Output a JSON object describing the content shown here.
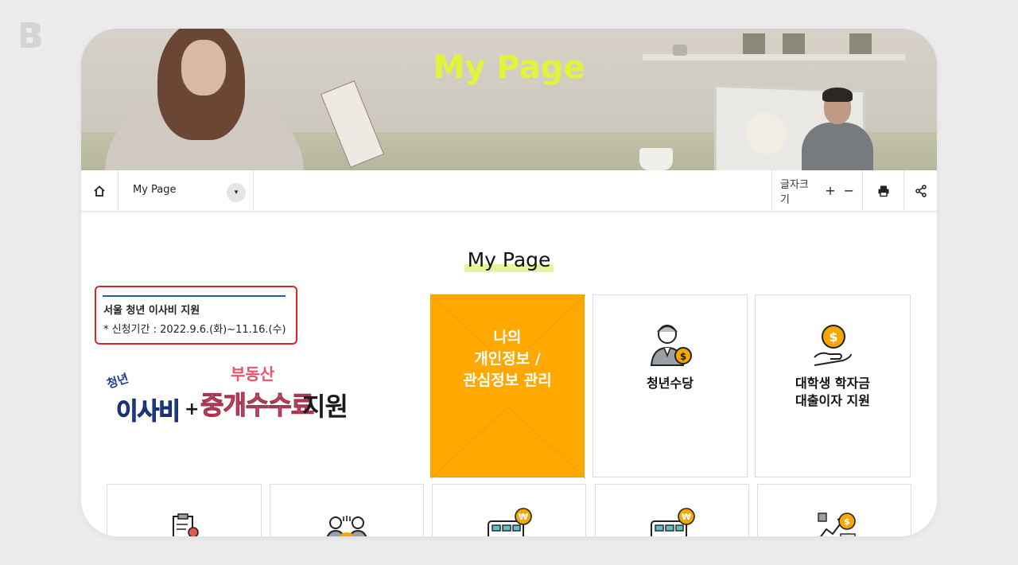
{
  "hero": {
    "title": "My Page"
  },
  "toolbar": {
    "select_label": "My Page",
    "select_arrow": "▾",
    "font_label": "글자크기",
    "font_plus": "+",
    "font_minus": "−"
  },
  "section": {
    "title": "My Page"
  },
  "notice": {
    "title": "서울 청년 이사비 지원",
    "period": "* 신청기간 : 2022.9.6.(화)~11.16.(수)"
  },
  "promo": {
    "small": "청년",
    "main": "이사비",
    "plus": "+",
    "top": "부동산",
    "pink": "중개수수료",
    "black": "지원"
  },
  "cards": [
    {
      "label": "나의\n개인정보 /\n관심정보 관리",
      "icon": "none"
    },
    {
      "label": "청년수당",
      "icon": "person-money-icon"
    },
    {
      "label": "대학생 학자금\n대출이자 지원",
      "icon": "coin-hand-icon"
    }
  ],
  "bottom_icons": [
    "clipboard-icon",
    "meeting-icon",
    "bus-won-icon",
    "bus-won-icon",
    "growth-coin-icon"
  ],
  "colors": {
    "accent": "#ffa800",
    "title_yellow": "#e3f23a",
    "highlight": "#e4f59c",
    "notice_border": "#d8262b"
  }
}
